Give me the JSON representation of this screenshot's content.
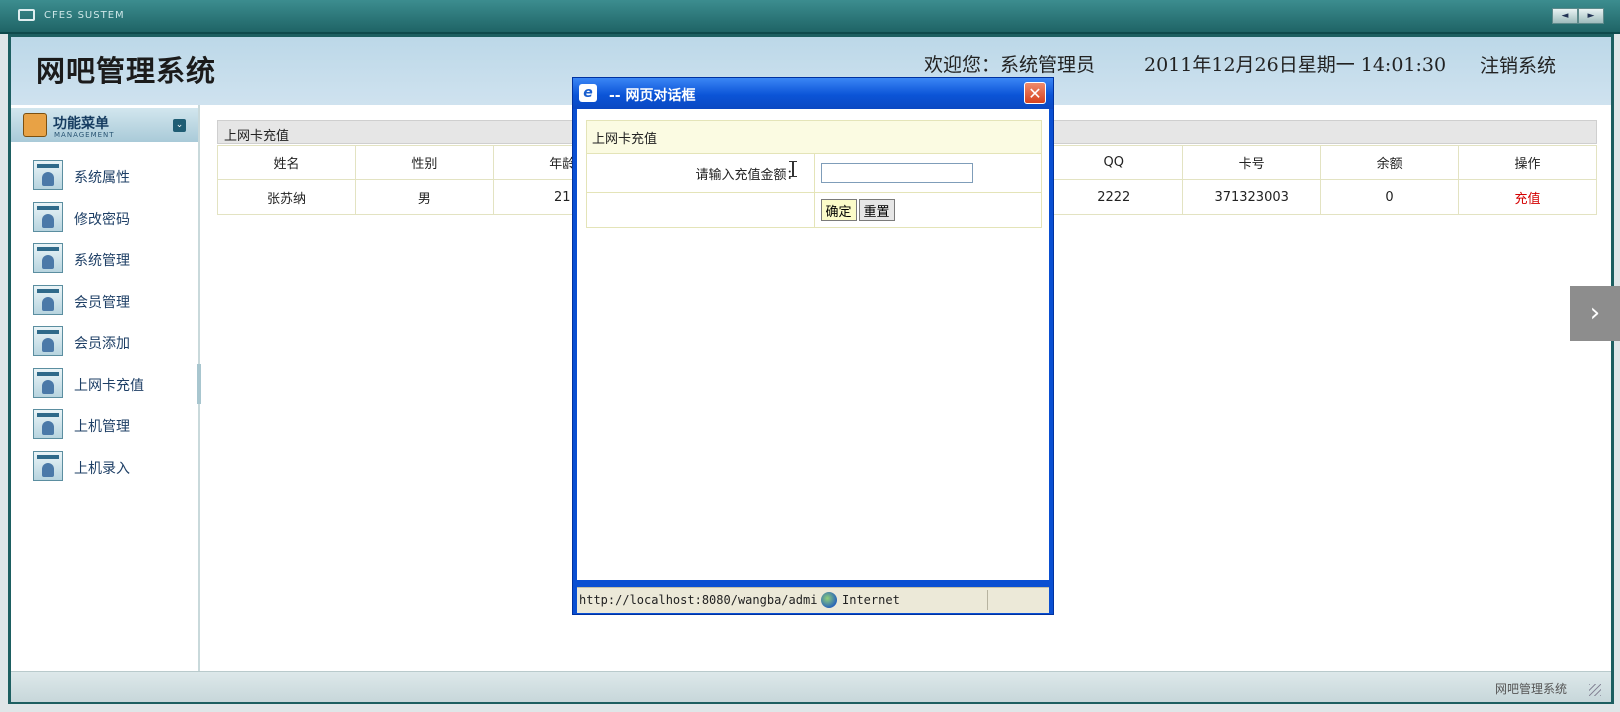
{
  "window": {
    "system_name": "CFES SUSTEM",
    "prev_icon": "◄",
    "next_icon": "►"
  },
  "header": {
    "site_title": "网吧管理系统",
    "welcome": "欢迎您：系统管理员",
    "datetime": "2011年12月26日星期一  14:01:30",
    "logout": "注销系统"
  },
  "sidebar": {
    "title": "功能菜单",
    "subtitle": "MANAGEMENT",
    "toggle_icon": "chevron-down-icon",
    "items": [
      {
        "label": "系统属性"
      },
      {
        "label": "修改密码"
      },
      {
        "label": "系统管理"
      },
      {
        "label": "会员管理"
      },
      {
        "label": "会员添加"
      },
      {
        "label": "上网卡充值"
      },
      {
        "label": "上机管理"
      },
      {
        "label": "上机录入"
      }
    ]
  },
  "panel": {
    "title": "上网卡充值",
    "columns": [
      "姓名",
      "性别",
      "年龄",
      "",
      "",
      "",
      "QQ",
      "卡号",
      "余额",
      "操作"
    ],
    "rows": [
      {
        "name": "张苏纳",
        "gender": "男",
        "age": "21",
        "c4": "",
        "c5": "",
        "c6": "",
        "qq": "2222",
        "card": "371323003",
        "balance": "0",
        "action": "充值"
      }
    ]
  },
  "statusbar": {
    "text": "网吧管理系统"
  },
  "dialog": {
    "title": "-- 网页对话框",
    "close_icon": "✕",
    "form_title": "上网卡充值",
    "amount_label": "请输入充值金额：",
    "amount_value": "",
    "ok_label": "确定",
    "reset_label": "重置",
    "status_url": "http://localhost:8080/wangba/admi",
    "status_zone": "Internet"
  }
}
